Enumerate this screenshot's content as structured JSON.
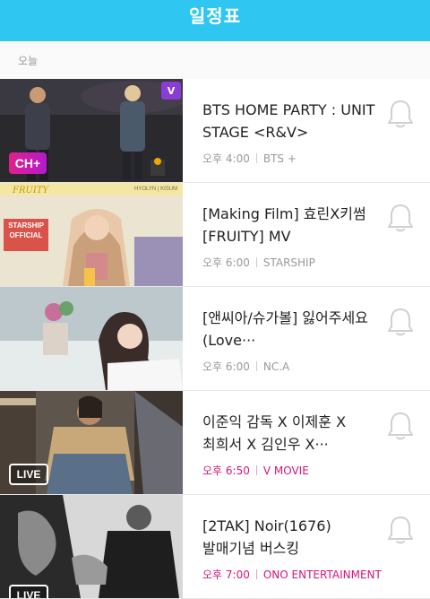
{
  "header": {
    "title": "일정표"
  },
  "section": {
    "label": "오늘"
  },
  "items": [
    {
      "title": "BTS HOME PARTY : UNIT STAGE <R&V>",
      "time": "오후 4:00",
      "channel": "BTS +",
      "live": false,
      "badge": "CH+",
      "corner_badge": "V"
    },
    {
      "title": "[Making Film] 효린X키썸 [FRUITY] MV",
      "time": "오후 6:00",
      "channel": "STARSHIP",
      "live": false,
      "overlay_text": "FRUITY",
      "overlay_sub": "HYOLYN | KISUM",
      "logo_text": "STARSHIP OFFICIAL"
    },
    {
      "title": "[앤씨아/슈가볼] 잃어주세요(Love···",
      "time": "오후 6:00",
      "channel": "NC.A",
      "live": false
    },
    {
      "title": "이준익 감독 X 이제훈 X 최희서 X 김인우 X···",
      "time": "오후 6:50",
      "channel": "V MOVIE",
      "live": true,
      "badge": "LIVE"
    },
    {
      "title": "[2TAK] Noir(1676) 발매기념 버스킹",
      "time": "오후 7:00",
      "channel": "ONO ENTERTAINMENT",
      "live": true,
      "badge": "LIVE"
    }
  ],
  "colors": {
    "header": "#2fc6f2",
    "live_accent": "#d4147b",
    "meta_gray": "#999999"
  },
  "icons": {
    "notify": "bell-icon"
  }
}
